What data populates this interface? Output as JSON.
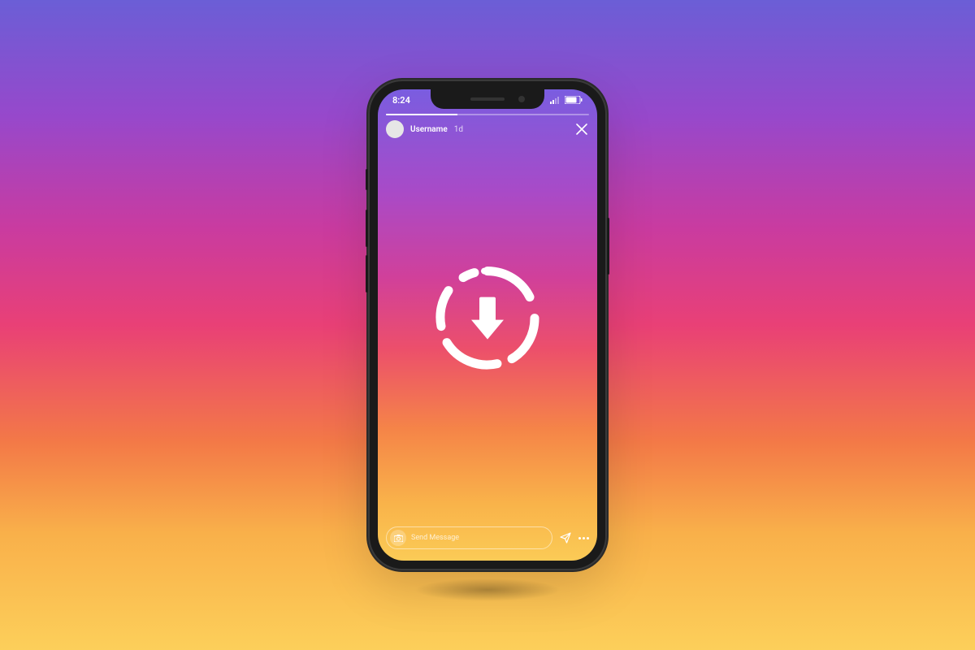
{
  "status": {
    "time": "8:24"
  },
  "story": {
    "username": "Username",
    "timestamp": "1d"
  },
  "reply": {
    "placeholder": "Send Message"
  }
}
